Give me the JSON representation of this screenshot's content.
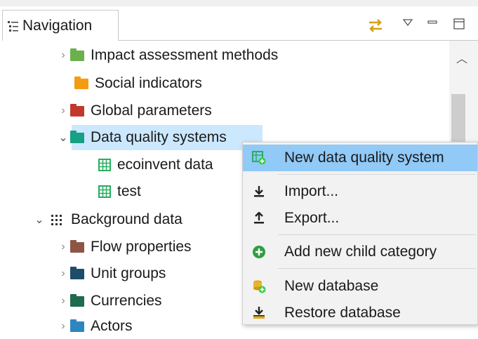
{
  "view": {
    "tab_label": "Navigation"
  },
  "tree": [
    {
      "label": "Impact assessment methods",
      "color": "#6ab04c"
    },
    {
      "label": "Social indicators",
      "color": "#f39c12"
    },
    {
      "label": "Global parameters",
      "color": "#c0392b"
    },
    {
      "label": "Data quality systems",
      "color": "#16a085"
    },
    {
      "label": "ecoinvent data",
      "color": "#27ae60"
    },
    {
      "label": "test",
      "color": "#27ae60"
    },
    {
      "label": "Background data"
    },
    {
      "label": "Flow properties",
      "color": "#8e5545"
    },
    {
      "label": "Unit groups",
      "color": "#1e4d6b"
    },
    {
      "label": "Currencies",
      "color": "#1e6b4d"
    },
    {
      "label": "Actors",
      "color": "#2e86c1"
    }
  ],
  "context_menu": {
    "items": [
      {
        "label": "New data quality system",
        "icon": "new-dq-system-icon"
      },
      {
        "label": "Import...",
        "icon": "import-icon"
      },
      {
        "label": "Export...",
        "icon": "export-icon"
      },
      {
        "label": "Add new child category",
        "icon": "add-category-icon"
      },
      {
        "label": "New database",
        "icon": "new-database-icon"
      },
      {
        "label": "Restore database",
        "icon": "restore-database-icon"
      }
    ]
  }
}
